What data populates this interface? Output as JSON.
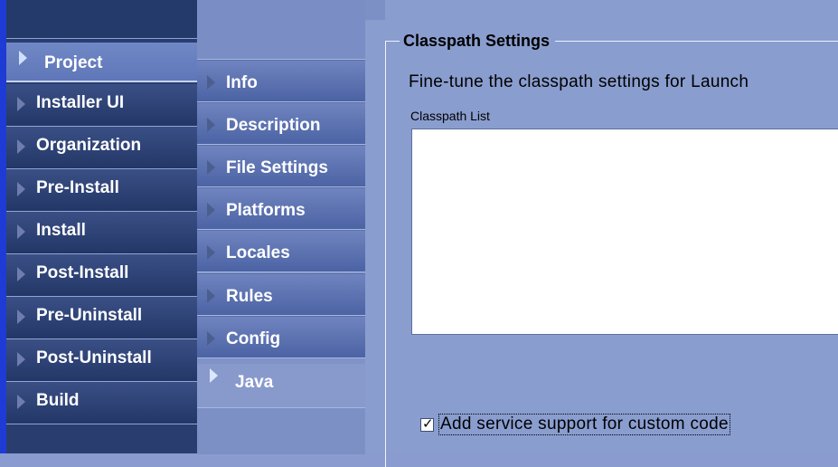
{
  "nav_primary": {
    "items": [
      {
        "label": "Project",
        "selected": true
      },
      {
        "label": "Installer UI"
      },
      {
        "label": "Organization"
      },
      {
        "label": "Pre-Install"
      },
      {
        "label": "Install"
      },
      {
        "label": "Post-Install"
      },
      {
        "label": "Pre-Uninstall"
      },
      {
        "label": "Post-Uninstall"
      },
      {
        "label": "Build"
      }
    ]
  },
  "nav_secondary": {
    "items": [
      {
        "label": "Info"
      },
      {
        "label": "Description"
      },
      {
        "label": "File Settings"
      },
      {
        "label": "Platforms"
      },
      {
        "label": "Locales"
      },
      {
        "label": "Rules"
      },
      {
        "label": "Config"
      },
      {
        "label": "Java",
        "selected": true
      }
    ]
  },
  "content": {
    "group_title": "Classpath Settings",
    "description": "Fine-tune the classpath settings for Launch",
    "list_label": "Classpath List",
    "service_support": {
      "label": "Add service support for custom code",
      "checked": true,
      "check_glyph": "✓"
    }
  },
  "colors": {
    "accent": "#1f3bd6",
    "nav_primary_bg": "#2a3d6f",
    "nav_selected_bg": "#6a81c0",
    "content_bg": "#8a9dcf"
  },
  "icons": {
    "nav_item": "triangle-right-icon"
  }
}
